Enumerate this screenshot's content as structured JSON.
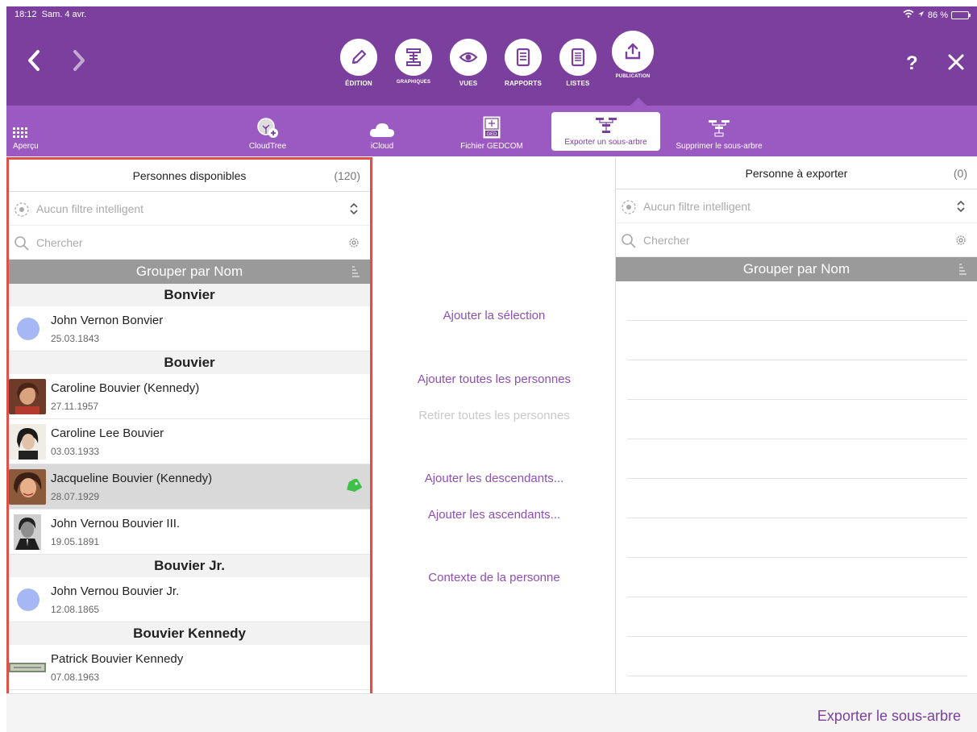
{
  "status": {
    "time": "18:12",
    "date": "Sam. 4 avr.",
    "battery": "86 %"
  },
  "toolbar": {
    "tools": [
      {
        "label": "ÉDITION",
        "icon": "pencil-icon"
      },
      {
        "label": "GRAPHIQUES",
        "icon": "tree-chart-icon"
      },
      {
        "label": "VUES",
        "icon": "eye-icon"
      },
      {
        "label": "RAPPORTS",
        "icon": "report-icon"
      },
      {
        "label": "LISTES",
        "icon": "list-icon"
      },
      {
        "label": "PUBLICATION",
        "icon": "upload-icon"
      }
    ],
    "help": "?"
  },
  "subbar": {
    "items": [
      {
        "label": "Aperçu",
        "icon": "grid-icon"
      },
      {
        "label": "CloudTree",
        "icon": "cloudtree-icon"
      },
      {
        "label": "iCloud",
        "icon": "cloud-icon"
      },
      {
        "label": "Fichier GEDCOM",
        "icon": "ged-file-icon"
      },
      {
        "label": "Exporter un sous-arbre",
        "icon": "export-subtree-icon"
      },
      {
        "label": "Supprimer le sous-arbre",
        "icon": "delete-subtree-icon"
      }
    ]
  },
  "left_panel": {
    "title": "Personnes disponibles",
    "count": "(120)",
    "filter": "Aucun filtre intelligent",
    "search_placeholder": "Chercher",
    "group_by": "Grouper par Nom",
    "sections": [
      {
        "name": "Bonvier",
        "rows": [
          {
            "name": "John Vernon Bonvier",
            "date": "25.03.1843"
          }
        ]
      },
      {
        "name": "Bouvier",
        "rows": [
          {
            "name": "Caroline Bouvier (Kennedy)",
            "date": "27.11.1957"
          },
          {
            "name": "Caroline Lee Bouvier",
            "date": "03.03.1933"
          },
          {
            "name": "Jacqueline Bouvier (Kennedy)",
            "date": "28.07.1929"
          },
          {
            "name": "John Vernou Bouvier III.",
            "date": "19.05.1891"
          }
        ]
      },
      {
        "name": "Bouvier Jr.",
        "rows": [
          {
            "name": "John Vernou Bouvier Jr.",
            "date": "12.08.1865"
          }
        ]
      },
      {
        "name": "Bouvier Kennedy",
        "rows": [
          {
            "name": "Patrick Bouvier Kennedy",
            "date": "07.08.1963"
          }
        ]
      }
    ]
  },
  "middle": {
    "add_selection": "Ajouter la sélection",
    "add_all": "Ajouter toutes les personnes",
    "remove_all": "Retirer toutes les personnes",
    "add_descendants": "Ajouter les descendants...",
    "add_ancestors": "Ajouter les ascendants...",
    "person_context": "Contexte de la personne"
  },
  "right_panel": {
    "title": "Personne à exporter",
    "count": "(0)",
    "filter": "Aucun filtre intelligent",
    "search_placeholder": "Chercher",
    "group_by": "Grouper par Nom"
  },
  "bottom": {
    "export_label": "Exporter le sous-arbre"
  },
  "colors": {
    "primary": "#7b3f9e",
    "secondary": "#9b59c2",
    "link": "#8e4fb5",
    "highlight_border": "#e0504a",
    "avatar_placeholder": "#a5b8f5",
    "tag": "#3ec04a"
  }
}
